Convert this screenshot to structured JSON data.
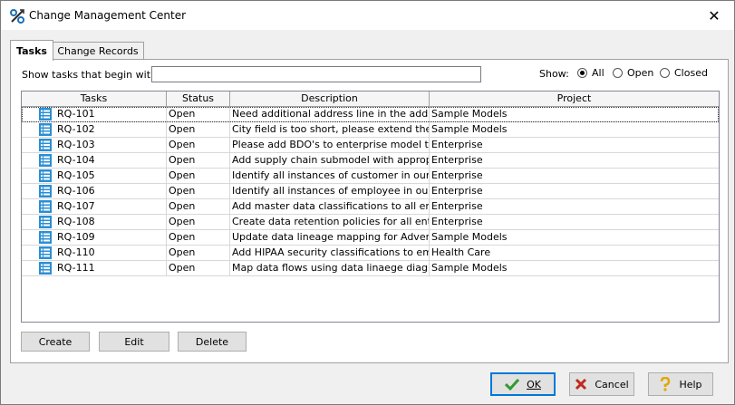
{
  "window": {
    "title": "Change Management Center",
    "close_glyph": "✕"
  },
  "tabs": [
    {
      "label": "Tasks",
      "active": true
    },
    {
      "label": "Change Records",
      "active": false
    }
  ],
  "filter": {
    "label": "Show tasks that begin with:",
    "value": ""
  },
  "show": {
    "label": "Show:",
    "options": [
      {
        "label": "All",
        "selected": true
      },
      {
        "label": "Open",
        "selected": false
      },
      {
        "label": "Closed",
        "selected": false
      }
    ]
  },
  "grid": {
    "columns": [
      "Tasks",
      "Status",
      "Description",
      "Project"
    ],
    "rows": [
      {
        "task": "RQ-101",
        "status": "Open",
        "description": "Need additional address line in the addres...",
        "project": "Sample Models"
      },
      {
        "task": "RQ-102",
        "status": "Open",
        "description": "City field is too short, please extend the l...",
        "project": "Sample Models"
      },
      {
        "task": "RQ-103",
        "status": "Open",
        "description": "Please add BDO's to enterprise model to d...",
        "project": "Enterprise"
      },
      {
        "task": "RQ-104",
        "status": "Open",
        "description": "Add supply chain submodel with appropria...",
        "project": "Enterprise"
      },
      {
        "task": "RQ-105",
        "status": "Open",
        "description": "Identify all instances of customer in our d...",
        "project": "Enterprise"
      },
      {
        "task": "RQ-106",
        "status": "Open",
        "description": "Identify all instances of employee in our d...",
        "project": "Enterprise"
      },
      {
        "task": "RQ-107",
        "status": "Open",
        "description": "Add master data classifications to all enter...",
        "project": "Enterprise"
      },
      {
        "task": "RQ-108",
        "status": "Open",
        "description": "Create data retention policies for all enter...",
        "project": "Enterprise"
      },
      {
        "task": "RQ-109",
        "status": "Open",
        "description": "Update data lineage mapping for Adventu...",
        "project": "Sample Models"
      },
      {
        "task": "RQ-110",
        "status": "Open",
        "description": "Add HIPAA security classifications to emer...",
        "project": "Health Care"
      },
      {
        "task": "RQ-111",
        "status": "Open",
        "description": "Map data flows using data linaege diagra...",
        "project": "Sample Models"
      }
    ]
  },
  "actions": {
    "create": "Create",
    "edit": "Edit",
    "delete": "Delete"
  },
  "footer": {
    "ok": "OK",
    "cancel": "Cancel",
    "help": "Help"
  },
  "icons": {
    "app": "change-management-icon",
    "task": "task-list-icon",
    "ok": "checkmark-icon",
    "cancel": "x-icon",
    "help": "question-icon"
  },
  "colors": {
    "task_icon": "#2a8fd4",
    "ok_check": "#2e9b2e",
    "cancel_x": "#c0281e",
    "help_q": "#e0a800",
    "accent": "#0078d7"
  }
}
